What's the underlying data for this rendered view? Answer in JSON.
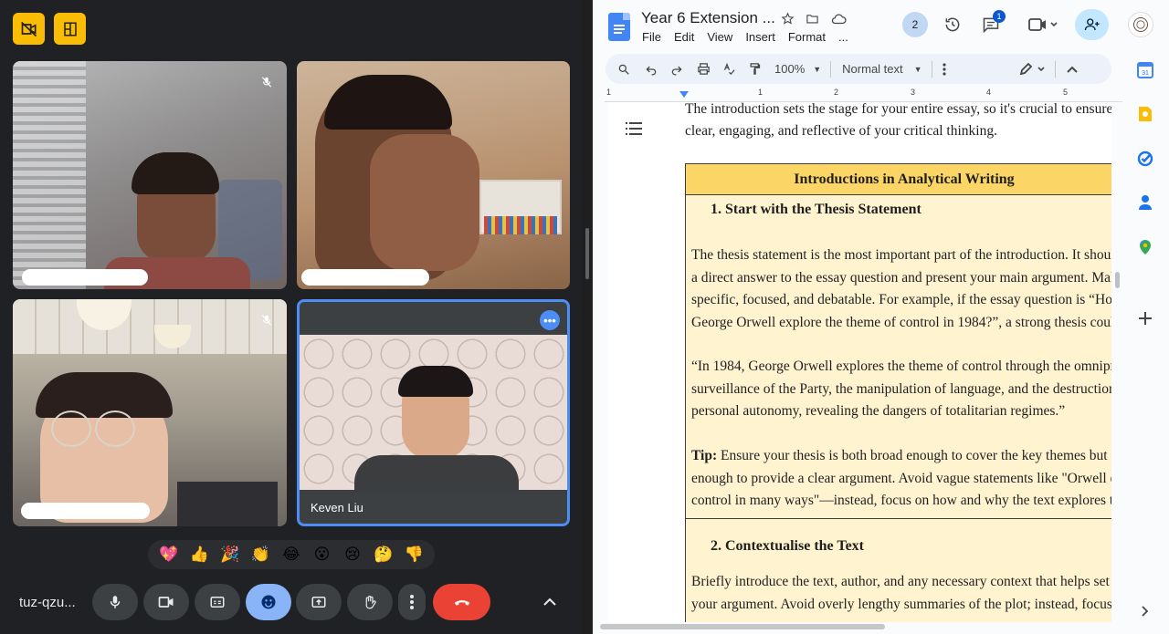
{
  "meet": {
    "participants": [
      {
        "name": "",
        "muted": true
      },
      {
        "name": "",
        "muted": false
      },
      {
        "name": "",
        "muted": true
      },
      {
        "name": "Keven Liu",
        "muted": false
      }
    ],
    "reactions": [
      "💖",
      "👍",
      "🎉",
      "👏",
      "😂",
      "😮",
      "😢",
      "🤔",
      "👎"
    ],
    "meeting_code": "tuz-qzu...",
    "colors": {
      "accent": "#fbbc04",
      "active": "#8ab4f8",
      "end_call": "#ea4335",
      "pinned_border": "#4c8df6"
    },
    "icons": {
      "top_left": "camera-off-icon",
      "top_right": "split-layout-icon",
      "controls": [
        "mic-icon",
        "camera-icon",
        "captions-icon",
        "emoji-icon",
        "present-icon",
        "raise-hand-icon",
        "more-vert-icon",
        "end-call-icon",
        "chevron-up-icon"
      ]
    }
  },
  "docs": {
    "title": "Year 6 Extension ...",
    "menu": [
      "File",
      "Edit",
      "View",
      "Insert",
      "Format",
      "..."
    ],
    "collaborators_count": "2",
    "comments_count": "1",
    "toolbar": {
      "zoom": "100%",
      "style": "Normal text"
    },
    "ruler_numbers": [
      "1",
      "1",
      "2",
      "3",
      "4",
      "5"
    ],
    "content": {
      "intro_lines": [
        "The introduction sets the stage for your entire essay, so it's crucial to ensure it is",
        "clear, engaging, and reflective of your critical thinking."
      ],
      "box_title": "Introductions in Analytical Writing",
      "sections": [
        {
          "heading": "1.  Start with the Thesis Statement",
          "paragraphs": [
            [
              "The thesis statement is the most important part of the introduction. It should be",
              "a direct answer to the essay question and present your main argument. Make it",
              "specific, focused, and debatable. For example, if the essay question is “How does",
              "George Orwell explore the theme of control in 1984?”, a strong thesis could be:"
            ],
            [
              "“In 1984, George Orwell explores the theme of control through the omnipresent",
              "surveillance of the Party, the manipulation of language, and the destruction of",
              "personal autonomy, revealing the dangers of totalitarian regimes.”"
            ]
          ],
          "tip_label": "Tip:",
          "tip_lines": [
            " Ensure your thesis is both broad enough to cover the key themes but specific",
            "enough to provide a clear argument. Avoid vague statements like \"Orwell explores",
            "control in many ways\"—instead, focus on how and why the text explores this."
          ]
        },
        {
          "heading": "2.  Contextualise the Text",
          "paragraphs": [
            [
              "Briefly introduce the text, author, and any necessary context that helps set the",
              "your argument. Avoid overly lengthy summaries of the plot; instead, focus on"
            ]
          ]
        }
      ]
    },
    "side_panel_icons": [
      "calendar-icon",
      "keep-icon",
      "tasks-icon",
      "contacts-icon",
      "maps-icon",
      "add-icon"
    ]
  }
}
